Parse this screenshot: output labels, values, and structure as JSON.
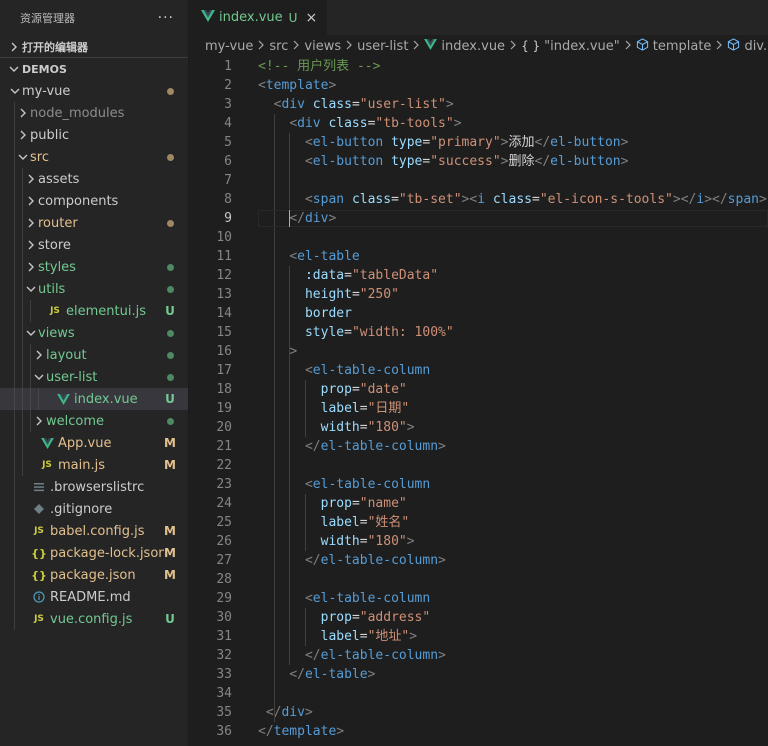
{
  "explorer": {
    "title": "资源管理器",
    "more_label": "···",
    "open_editors_label": "打开的编辑器",
    "workspace_label": "DEMOS",
    "tree": [
      {
        "label": "my-vue",
        "depth": 0,
        "type": "folder",
        "open": true,
        "color": "normal",
        "status": "dot-mod"
      },
      {
        "label": "node_modules",
        "depth": 1,
        "type": "folder",
        "open": false,
        "color": "dim",
        "status": ""
      },
      {
        "label": "public",
        "depth": 1,
        "type": "folder",
        "open": false,
        "color": "normal",
        "status": ""
      },
      {
        "label": "src",
        "depth": 1,
        "type": "folder",
        "open": true,
        "color": "mod",
        "status": "dot-mod"
      },
      {
        "label": "assets",
        "depth": 2,
        "type": "folder",
        "open": false,
        "color": "normal",
        "status": ""
      },
      {
        "label": "components",
        "depth": 2,
        "type": "folder",
        "open": false,
        "color": "normal",
        "status": ""
      },
      {
        "label": "router",
        "depth": 2,
        "type": "folder",
        "open": false,
        "color": "mod",
        "status": "dot-mod"
      },
      {
        "label": "store",
        "depth": 2,
        "type": "folder",
        "open": false,
        "color": "normal",
        "status": ""
      },
      {
        "label": "styles",
        "depth": 2,
        "type": "folder",
        "open": false,
        "color": "untracked",
        "status": "dot-untracked"
      },
      {
        "label": "utils",
        "depth": 2,
        "type": "folder",
        "open": true,
        "color": "untracked",
        "status": "dot-untracked"
      },
      {
        "label": "elementui.js",
        "depth": 3,
        "type": "js",
        "color": "untracked",
        "status": "U"
      },
      {
        "label": "views",
        "depth": 2,
        "type": "folder",
        "open": true,
        "color": "untracked",
        "status": "dot-untracked"
      },
      {
        "label": "layout",
        "depth": 3,
        "type": "folder",
        "open": false,
        "color": "untracked",
        "status": "dot-untracked"
      },
      {
        "label": "user-list",
        "depth": 3,
        "type": "folder",
        "open": true,
        "color": "untracked",
        "status": "dot-untracked"
      },
      {
        "label": "index.vue",
        "depth": 4,
        "type": "vue",
        "color": "untracked",
        "status": "U",
        "selected": true
      },
      {
        "label": "welcome",
        "depth": 3,
        "type": "folder",
        "open": false,
        "color": "untracked",
        "status": "dot-untracked"
      },
      {
        "label": "App.vue",
        "depth": 2,
        "type": "vue",
        "color": "mod",
        "status": "M"
      },
      {
        "label": "main.js",
        "depth": 2,
        "type": "js",
        "color": "mod",
        "status": "M"
      },
      {
        "label": ".browserslistrc",
        "depth": 1,
        "type": "list",
        "color": "normal",
        "status": ""
      },
      {
        "label": ".gitignore",
        "depth": 1,
        "type": "git",
        "color": "normal",
        "status": ""
      },
      {
        "label": "babel.config.js",
        "depth": 1,
        "type": "js",
        "color": "mod",
        "status": "M"
      },
      {
        "label": "package-lock.json",
        "depth": 1,
        "type": "json",
        "color": "mod",
        "status": "M"
      },
      {
        "label": "package.json",
        "depth": 1,
        "type": "json",
        "color": "mod",
        "status": "M"
      },
      {
        "label": "README.md",
        "depth": 1,
        "type": "info",
        "color": "normal",
        "status": ""
      },
      {
        "label": "vue.config.js",
        "depth": 1,
        "type": "js",
        "color": "untracked",
        "status": "U"
      }
    ]
  },
  "editor": {
    "tab": {
      "label": "index.vue",
      "badge": "U",
      "close": "×"
    },
    "breadcrumb": [
      {
        "label": "my-vue",
        "icon": ""
      },
      {
        "label": "src",
        "icon": ""
      },
      {
        "label": "views",
        "icon": ""
      },
      {
        "label": "user-list",
        "icon": ""
      },
      {
        "label": "index.vue",
        "icon": "vue"
      },
      {
        "label": "\"index.vue\"",
        "icon": "braces"
      },
      {
        "label": "template",
        "icon": "cube"
      },
      {
        "label": "div.user-list",
        "icon": "cube"
      }
    ],
    "active_line": 9,
    "lines": [
      {
        "n": 1,
        "indent": 0,
        "tokens": [
          [
            "cmt",
            "<!-- 用户列表 -->"
          ]
        ]
      },
      {
        "n": 2,
        "indent": 0,
        "tokens": [
          [
            "br",
            "<"
          ],
          [
            "tag",
            "template"
          ],
          [
            "br",
            ">"
          ]
        ]
      },
      {
        "n": 3,
        "indent": 2,
        "tokens": [
          [
            "br",
            "<"
          ],
          [
            "tag",
            "div"
          ],
          [
            "txt",
            " "
          ],
          [
            "attr",
            "class"
          ],
          [
            "eq",
            "="
          ],
          [
            "str",
            "\"user-list\""
          ],
          [
            "br",
            ">"
          ]
        ]
      },
      {
        "n": 4,
        "indent": 4,
        "tokens": [
          [
            "br",
            "<"
          ],
          [
            "tag",
            "div"
          ],
          [
            "txt",
            " "
          ],
          [
            "attr",
            "class"
          ],
          [
            "eq",
            "="
          ],
          [
            "str",
            "\"tb-tools\""
          ],
          [
            "br",
            ">"
          ]
        ]
      },
      {
        "n": 5,
        "indent": 6,
        "tokens": [
          [
            "br",
            "<"
          ],
          [
            "tag",
            "el-button"
          ],
          [
            "txt",
            " "
          ],
          [
            "attr",
            "type"
          ],
          [
            "eq",
            "="
          ],
          [
            "str",
            "\"primary\""
          ],
          [
            "br",
            ">"
          ],
          [
            "txt",
            "添加"
          ],
          [
            "br",
            "</"
          ],
          [
            "tag",
            "el-button"
          ],
          [
            "br",
            ">"
          ]
        ]
      },
      {
        "n": 6,
        "indent": 6,
        "tokens": [
          [
            "br",
            "<"
          ],
          [
            "tag",
            "el-button"
          ],
          [
            "txt",
            " "
          ],
          [
            "attr",
            "type"
          ],
          [
            "eq",
            "="
          ],
          [
            "str",
            "\"success\""
          ],
          [
            "br",
            ">"
          ],
          [
            "txt",
            "删除"
          ],
          [
            "br",
            "</"
          ],
          [
            "tag",
            "el-button"
          ],
          [
            "br",
            ">"
          ]
        ]
      },
      {
        "n": 7,
        "indent": 0,
        "tokens": []
      },
      {
        "n": 8,
        "indent": 6,
        "tokens": [
          [
            "br",
            "<"
          ],
          [
            "tag",
            "span"
          ],
          [
            "txt",
            " "
          ],
          [
            "attr",
            "class"
          ],
          [
            "eq",
            "="
          ],
          [
            "str",
            "\"tb-set\""
          ],
          [
            "br",
            ">"
          ],
          [
            "br",
            "<"
          ],
          [
            "tag",
            "i"
          ],
          [
            "txt",
            " "
          ],
          [
            "attr",
            "class"
          ],
          [
            "eq",
            "="
          ],
          [
            "str",
            "\"el-icon-s-tools\""
          ],
          [
            "br",
            ">"
          ],
          [
            "br",
            "</"
          ],
          [
            "tag",
            "i"
          ],
          [
            "br",
            ">"
          ],
          [
            "br",
            "</"
          ],
          [
            "tag",
            "span"
          ],
          [
            "br",
            ">"
          ]
        ]
      },
      {
        "n": 9,
        "indent": 4,
        "tokens": [
          [
            "br",
            "</"
          ],
          [
            "tag",
            "div"
          ],
          [
            "br",
            ">"
          ]
        ]
      },
      {
        "n": 10,
        "indent": 0,
        "tokens": []
      },
      {
        "n": 11,
        "indent": 4,
        "tokens": [
          [
            "br",
            "<"
          ],
          [
            "tag",
            "el-table"
          ]
        ]
      },
      {
        "n": 12,
        "indent": 6,
        "tokens": [
          [
            "attr",
            ":data"
          ],
          [
            "eq",
            "="
          ],
          [
            "str",
            "\"tableData\""
          ]
        ]
      },
      {
        "n": 13,
        "indent": 6,
        "tokens": [
          [
            "attr",
            "height"
          ],
          [
            "eq",
            "="
          ],
          [
            "str",
            "\"250\""
          ]
        ]
      },
      {
        "n": 14,
        "indent": 6,
        "tokens": [
          [
            "attr",
            "border"
          ]
        ]
      },
      {
        "n": 15,
        "indent": 6,
        "tokens": [
          [
            "attr",
            "style"
          ],
          [
            "eq",
            "="
          ],
          [
            "str",
            "\"width: 100%\""
          ]
        ]
      },
      {
        "n": 16,
        "indent": 4,
        "tokens": [
          [
            "br",
            ">"
          ]
        ]
      },
      {
        "n": 17,
        "indent": 6,
        "tokens": [
          [
            "br",
            "<"
          ],
          [
            "tag",
            "el-table-column"
          ]
        ]
      },
      {
        "n": 18,
        "indent": 8,
        "tokens": [
          [
            "attr",
            "prop"
          ],
          [
            "eq",
            "="
          ],
          [
            "str",
            "\"date\""
          ]
        ]
      },
      {
        "n": 19,
        "indent": 8,
        "tokens": [
          [
            "attr",
            "label"
          ],
          [
            "eq",
            "="
          ],
          [
            "str",
            "\"日期\""
          ]
        ]
      },
      {
        "n": 20,
        "indent": 8,
        "tokens": [
          [
            "attr",
            "width"
          ],
          [
            "eq",
            "="
          ],
          [
            "str",
            "\"180\""
          ],
          [
            "br",
            ">"
          ]
        ]
      },
      {
        "n": 21,
        "indent": 6,
        "tokens": [
          [
            "br",
            "</"
          ],
          [
            "tag",
            "el-table-column"
          ],
          [
            "br",
            ">"
          ]
        ]
      },
      {
        "n": 22,
        "indent": 0,
        "tokens": []
      },
      {
        "n": 23,
        "indent": 6,
        "tokens": [
          [
            "br",
            "<"
          ],
          [
            "tag",
            "el-table-column"
          ]
        ]
      },
      {
        "n": 24,
        "indent": 8,
        "tokens": [
          [
            "attr",
            "prop"
          ],
          [
            "eq",
            "="
          ],
          [
            "str",
            "\"name\""
          ]
        ]
      },
      {
        "n": 25,
        "indent": 8,
        "tokens": [
          [
            "attr",
            "label"
          ],
          [
            "eq",
            "="
          ],
          [
            "str",
            "\"姓名\""
          ]
        ]
      },
      {
        "n": 26,
        "indent": 8,
        "tokens": [
          [
            "attr",
            "width"
          ],
          [
            "eq",
            "="
          ],
          [
            "str",
            "\"180\""
          ],
          [
            "br",
            ">"
          ]
        ]
      },
      {
        "n": 27,
        "indent": 6,
        "tokens": [
          [
            "br",
            "</"
          ],
          [
            "tag",
            "el-table-column"
          ],
          [
            "br",
            ">"
          ]
        ]
      },
      {
        "n": 28,
        "indent": 0,
        "tokens": []
      },
      {
        "n": 29,
        "indent": 6,
        "tokens": [
          [
            "br",
            "<"
          ],
          [
            "tag",
            "el-table-column"
          ]
        ]
      },
      {
        "n": 30,
        "indent": 8,
        "tokens": [
          [
            "attr",
            "prop"
          ],
          [
            "eq",
            "="
          ],
          [
            "str",
            "\"address\""
          ]
        ]
      },
      {
        "n": 31,
        "indent": 8,
        "tokens": [
          [
            "attr",
            "label"
          ],
          [
            "eq",
            "="
          ],
          [
            "str",
            "\"地址\""
          ],
          [
            "br",
            ">"
          ]
        ]
      },
      {
        "n": 32,
        "indent": 6,
        "tokens": [
          [
            "br",
            "</"
          ],
          [
            "tag",
            "el-table-column"
          ],
          [
            "br",
            ">"
          ]
        ]
      },
      {
        "n": 33,
        "indent": 4,
        "tokens": [
          [
            "br",
            "</"
          ],
          [
            "tag",
            "el-table"
          ],
          [
            "br",
            ">"
          ]
        ]
      },
      {
        "n": 34,
        "indent": 0,
        "tokens": []
      },
      {
        "n": 35,
        "indent": 1,
        "tokens": [
          [
            "br",
            "</"
          ],
          [
            "tag",
            "div"
          ],
          [
            "br",
            ">"
          ]
        ]
      },
      {
        "n": 36,
        "indent": 0,
        "tokens": [
          [
            "br",
            "</"
          ],
          [
            "tag",
            "template"
          ],
          [
            "br",
            ">"
          ]
        ]
      }
    ]
  },
  "colors": {
    "git_modified": "#e2c08d",
    "git_untracked": "#73c991",
    "vue_icon": "#41b883"
  }
}
